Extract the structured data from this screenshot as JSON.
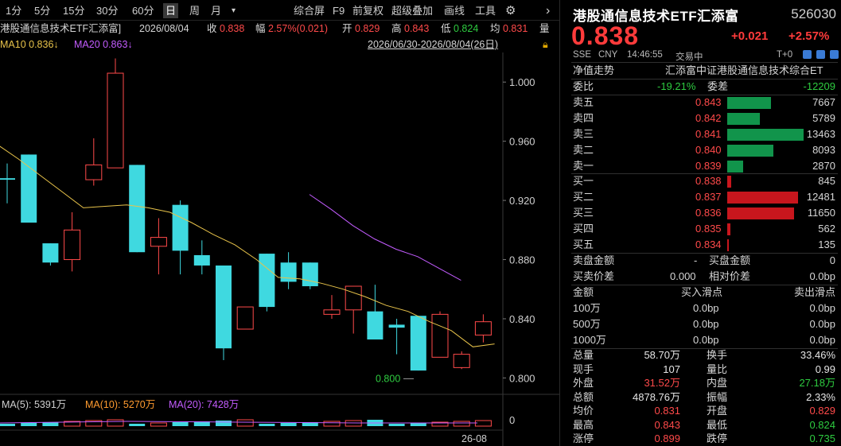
{
  "toolbar": {
    "periods": [
      "1分",
      "5分",
      "15分",
      "30分",
      "60分",
      "日",
      "周",
      "月"
    ],
    "active_period": "日",
    "dropdown_glyph": "▾",
    "tools": [
      "综合屏",
      "F9",
      "前复权",
      "超级叠加",
      "画线",
      "工具"
    ],
    "icons": [
      "settings-icon",
      "chevron-right-icon"
    ]
  },
  "infobar": {
    "name": "港股通信息技术ETF汇添富]",
    "date": "2026/08/04",
    "close_label": "收",
    "close": "0.838",
    "amp_label": "幅",
    "amp": "2.57%(0.021)",
    "open_label": "开",
    "open": "0.829",
    "high_label": "高",
    "high": "0.843",
    "low_label": "低",
    "low": "0.824",
    "avg_label": "均",
    "avg": "0.831",
    "tail": "量"
  },
  "mabar": {
    "ma10": "MA10 0.836↓",
    "ma20": "MA20 0.863↓",
    "range": "2026/06/30-2026/08/04(26日)"
  },
  "chart_data": {
    "type": "candlestick",
    "yaxis_ticks": [
      "1.000",
      "0.960",
      "0.920",
      "0.880",
      "0.840",
      "0.800"
    ],
    "ylim": [
      0.79,
      1.02
    ],
    "candles": [
      {
        "o": 0.935,
        "c": 0.934,
        "h": 0.945,
        "l": 0.918
      },
      {
        "o": 0.951,
        "c": 0.905,
        "h": 0.951,
        "l": 0.905
      },
      {
        "o": 0.891,
        "c": 0.878,
        "h": 0.891,
        "l": 0.876
      },
      {
        "o": 0.88,
        "c": 0.9,
        "h": 0.912,
        "l": 0.872
      },
      {
        "o": 0.934,
        "c": 0.944,
        "h": 0.962,
        "l": 0.93
      },
      {
        "o": 0.942,
        "c": 1.006,
        "h": 1.016,
        "l": 0.942
      },
      {
        "o": 0.944,
        "c": 0.885,
        "h": 0.944,
        "l": 0.885
      },
      {
        "o": 0.889,
        "c": 0.895,
        "h": 0.908,
        "l": 0.87
      },
      {
        "o": 0.917,
        "c": 0.886,
        "h": 0.92,
        "l": 0.87
      },
      {
        "o": 0.883,
        "c": 0.876,
        "h": 0.893,
        "l": 0.87
      },
      {
        "o": 0.876,
        "c": 0.82,
        "h": 0.876,
        "l": 0.812
      },
      {
        "o": 0.833,
        "c": 0.848,
        "h": 0.848,
        "l": 0.833
      },
      {
        "o": 0.884,
        "c": 0.848,
        "h": 0.884,
        "l": 0.845
      },
      {
        "o": 0.878,
        "c": 0.865,
        "h": 0.885,
        "l": 0.86
      },
      {
        "o": 0.878,
        "c": 0.862,
        "h": 0.878,
        "l": 0.86
      },
      {
        "o": 0.843,
        "c": 0.846,
        "h": 0.856,
        "l": 0.84
      },
      {
        "o": 0.846,
        "c": 0.862,
        "h": 0.862,
        "l": 0.83
      },
      {
        "o": 0.845,
        "c": 0.826,
        "h": 0.863,
        "l": 0.826
      },
      {
        "o": 0.836,
        "c": 0.834,
        "h": 0.84,
        "l": 0.816
      },
      {
        "o": 0.842,
        "c": 0.805,
        "h": 0.842,
        "l": 0.805
      },
      {
        "o": 0.814,
        "c": 0.843,
        "h": 0.845,
        "l": 0.814
      },
      {
        "o": 0.807,
        "c": 0.816,
        "h": 0.818,
        "l": 0.806
      },
      {
        "o": 0.829,
        "c": 0.838,
        "h": 0.843,
        "l": 0.824
      }
    ],
    "ma10_visible": [
      0.958,
      0.948,
      0.937,
      0.926,
      0.915,
      0.916,
      0.917,
      0.915,
      0.912,
      0.905,
      0.897,
      0.89,
      0.88,
      0.868,
      0.867,
      0.864,
      0.86,
      0.855,
      0.849,
      0.845,
      0.838,
      0.832,
      0.821,
      0.823
    ],
    "ma20_visible": [
      0.924,
      0.914,
      0.903,
      0.894,
      0.887,
      0.882,
      0.874,
      0.866
    ],
    "low_annotation": "0.800",
    "volume_ma_label": "MA(5): 5391万",
    "volume_ma10_label": "MA(10): 5270万",
    "volume_ma20_label": "MA(20): 7428万",
    "volume_axis": "0",
    "date_tick": "26-08"
  },
  "panel": {
    "title": "港股通信息技术ETF汇添富",
    "code": "526030",
    "price": "0.838",
    "change": "+0.021",
    "change_pct": "+2.57%",
    "market": "SSE",
    "currency": "CNY",
    "time": "14:46:55",
    "status": "交易中",
    "settle": "T+0",
    "nav_label": "净值走势",
    "nav_desc": "汇添富中证港股通信息技术综合ET",
    "weibi_label": "委比",
    "weibi": "-19.21%",
    "weicha_label": "委差",
    "weicha": "-12209",
    "asks": [
      {
        "label": "卖五",
        "price": "0.843",
        "vol": "7667",
        "ratio": 0.57
      },
      {
        "label": "卖四",
        "price": "0.842",
        "vol": "5789",
        "ratio": 0.43
      },
      {
        "label": "卖三",
        "price": "0.841",
        "vol": "13463",
        "ratio": 1.0
      },
      {
        "label": "卖二",
        "price": "0.840",
        "vol": "8093",
        "ratio": 0.6
      },
      {
        "label": "卖一",
        "price": "0.839",
        "vol": "2870",
        "ratio": 0.21
      }
    ],
    "bids": [
      {
        "label": "买一",
        "price": "0.838",
        "vol": "845",
        "ratio": 0.05
      },
      {
        "label": "买二",
        "price": "0.837",
        "vol": "12481",
        "ratio": 0.93
      },
      {
        "label": "买三",
        "price": "0.836",
        "vol": "11650",
        "ratio": 0.87
      },
      {
        "label": "买四",
        "price": "0.835",
        "vol": "562",
        "ratio": 0.04
      },
      {
        "label": "买五",
        "price": "0.834",
        "vol": "135",
        "ratio": 0.01
      }
    ],
    "sell_amt_label": "卖盘金额",
    "sell_amt": "-",
    "buy_amt_label": "买盘金额",
    "buy_amt": "0",
    "spread_label": "买卖价差",
    "spread": "0.000",
    "rel_spread_label": "相对价差",
    "rel_spread": "0.0bp",
    "slip_header": [
      "金额",
      "买入滑点",
      "卖出滑点"
    ],
    "slips": [
      {
        "amt": "100万",
        "buy": "0.0bp",
        "sell": "0.0bp"
      },
      {
        "amt": "500万",
        "buy": "0.0bp",
        "sell": "0.0bp"
      },
      {
        "amt": "1000万",
        "buy": "0.0bp",
        "sell": "0.0bp"
      }
    ],
    "stats": [
      {
        "l1": "总量",
        "v1": "58.70万",
        "c1": "white",
        "l2": "换手",
        "v2": "33.46%",
        "c2": "white"
      },
      {
        "l1": "现手",
        "v1": "107",
        "c1": "white",
        "l2": "量比",
        "v2": "0.99",
        "c2": "white"
      },
      {
        "l1": "外盘",
        "v1": "31.52万",
        "c1": "red",
        "l2": "内盘",
        "v2": "27.18万",
        "c2": "green"
      },
      {
        "l1": "总额",
        "v1": "4878.76万",
        "c1": "white",
        "l2": "振幅",
        "v2": "2.33%",
        "c2": "white"
      },
      {
        "l1": "均价",
        "v1": "0.831",
        "c1": "red",
        "l2": "开盘",
        "v2": "0.829",
        "c2": "red"
      },
      {
        "l1": "最高",
        "v1": "0.843",
        "c1": "red",
        "l2": "最低",
        "v2": "0.824",
        "c2": "green"
      },
      {
        "l1": "涨停",
        "v1": "0.899",
        "c1": "red",
        "l2": "跌停",
        "v2": "0.735",
        "c2": "green"
      }
    ]
  }
}
